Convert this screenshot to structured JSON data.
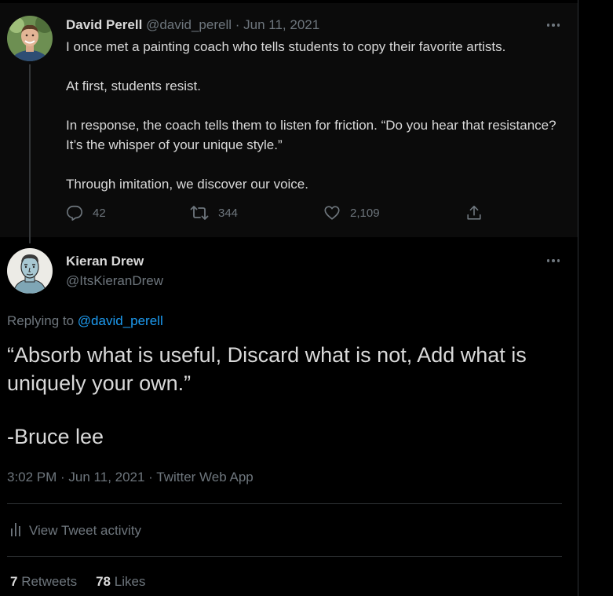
{
  "colors": {
    "background": "#000000",
    "parent_background": "#0b0b0b",
    "text_primary": "#d9d9d9",
    "text_secondary": "#6e767d",
    "link": "#1d9bf0",
    "divider": "#2f3336"
  },
  "parent_tweet": {
    "author_name": "David Perell",
    "author_handle": "@david_perell",
    "separator": "·",
    "date": "Jun 11, 2021",
    "paragraphs": [
      "I once met a painting coach who tells students to copy their favorite artists.",
      "At first, students resist.",
      "In response, the coach tells them to listen for friction. “Do you hear that resistance? It’s the whisper of your unique style.”",
      "Through imitation, we discover our voice."
    ],
    "actions": {
      "replies": "42",
      "retweets": "344",
      "likes": "2,109"
    },
    "icons": {
      "more": "more-horizontal-icon",
      "reply": "reply-icon",
      "retweet": "retweet-icon",
      "like": "heart-icon",
      "share": "share-icon"
    }
  },
  "reply_tweet": {
    "author_name": "Kieran Drew",
    "author_handle": "@ItsKieranDrew",
    "replying_to_prefix": "Replying to",
    "replying_to_handle": "@david_perell",
    "paragraphs": [
      "“Absorb what is useful, Discard what is not, Add what is uniquely your own.”",
      "-Bruce lee"
    ],
    "meta": "3:02 PM · Jun 11, 2021 · Twitter Web App",
    "activity_label": "View Tweet activity",
    "retweets_count": "7",
    "retweets_label": "Retweets",
    "likes_count": "78",
    "likes_label": "Likes",
    "icons": {
      "more": "more-horizontal-icon",
      "activity": "bar-chart-icon"
    }
  }
}
